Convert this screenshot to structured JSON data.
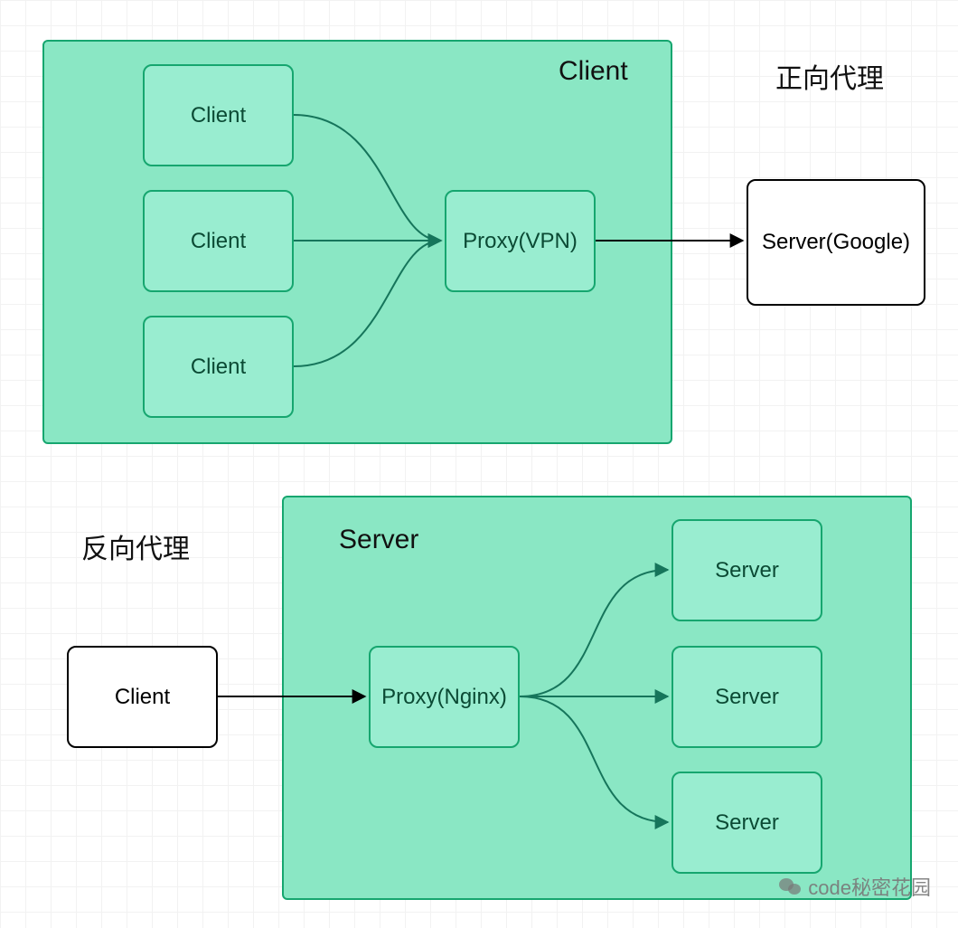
{
  "diagram": {
    "forward_proxy": {
      "title": "正向代理",
      "region_label": "Client",
      "clients": [
        "Client",
        "Client",
        "Client"
      ],
      "proxy": "Proxy(VPN)",
      "server": "Server(Google)"
    },
    "reverse_proxy": {
      "title": "反向代理",
      "region_label": "Server",
      "client": "Client",
      "proxy": "Proxy(Nginx)",
      "servers": [
        "Server",
        "Server",
        "Server"
      ]
    }
  },
  "watermark": {
    "text": "code秘密花园"
  },
  "colors": {
    "region_fill": "#8AE7C4",
    "region_stroke": "#16A66F",
    "node_fill": "#99EDD0",
    "node_stroke": "#16A66F",
    "external_stroke": "#000000",
    "grid": "#f2f2f2"
  }
}
